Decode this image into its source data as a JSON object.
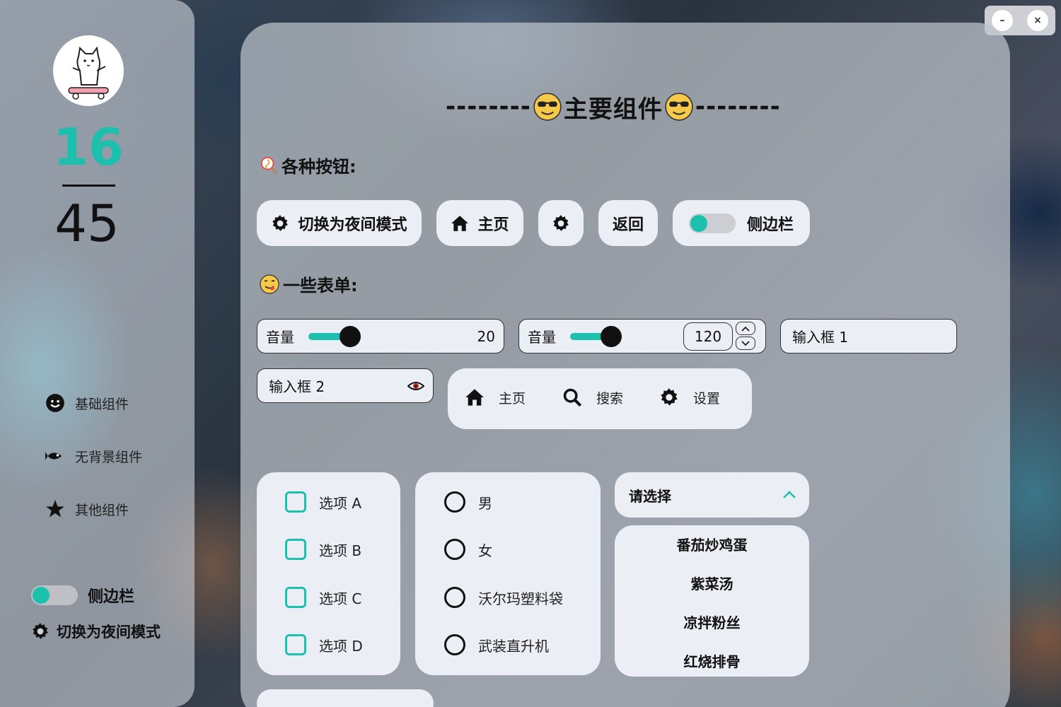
{
  "sidebar": {
    "clock": {
      "hour": "16",
      "minute": "45"
    },
    "nav": [
      {
        "label": "基础组件",
        "icon": "smile-icon"
      },
      {
        "label": "无背景组件",
        "icon": "fish-icon"
      },
      {
        "label": "其他组件",
        "icon": "star-icon"
      }
    ],
    "toggle_label": "侧边栏",
    "night_label": "切换为夜间模式"
  },
  "window": {
    "minimize": "–",
    "close": "×"
  },
  "main": {
    "title_left": "--------",
    "title_text": "主要组件",
    "title_right": "--------",
    "buttons_label": "各种按钮:",
    "forms_label": "一些表单:",
    "buttons": {
      "night": "切换为夜间模式",
      "home": "主页",
      "back": "返回",
      "sidebar": "侧边栏"
    },
    "slider1": {
      "label": "音量",
      "value": "20"
    },
    "slider2": {
      "label": "音量",
      "value": "120"
    },
    "input1": {
      "value": "输入框 1"
    },
    "input2": {
      "value": "输入框 2"
    },
    "navbar": [
      {
        "label": "主页",
        "icon": "home-icon"
      },
      {
        "label": "搜索",
        "icon": "search-icon"
      },
      {
        "label": "设置",
        "icon": "gear-icon"
      }
    ],
    "checkboxes": [
      "选项 A",
      "选项 B",
      "选项 C",
      "选项 D"
    ],
    "radios": [
      "男",
      "女",
      "沃尔玛塑料袋",
      "武装直升机"
    ],
    "select": {
      "placeholder": "请选择",
      "options": [
        "番茄炒鸡蛋",
        "紫菜汤",
        "凉拌粉丝",
        "红烧排骨"
      ]
    }
  },
  "colors": {
    "accent": "#1cc0ad",
    "card": "#eceef5"
  }
}
